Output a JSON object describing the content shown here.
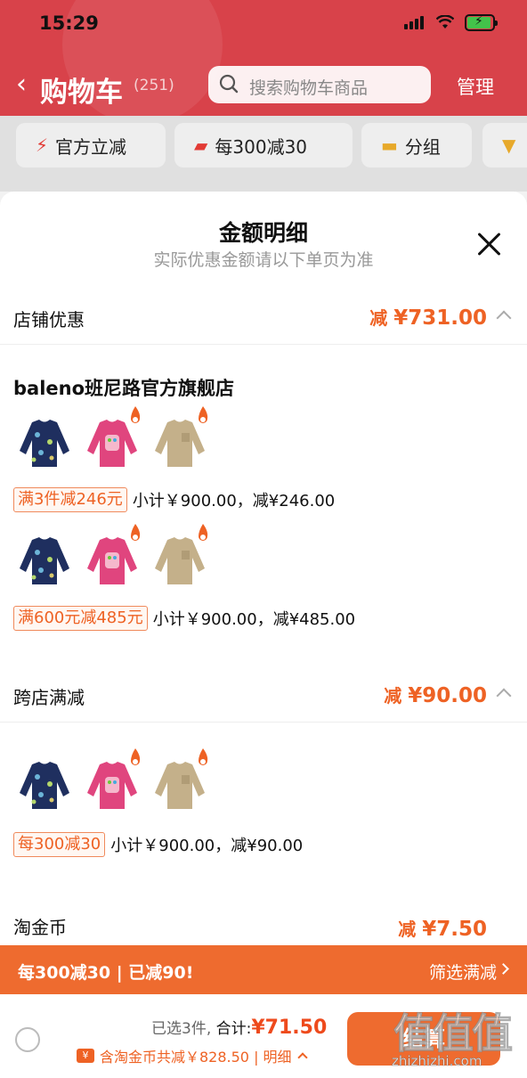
{
  "status_bar": {
    "time": "15:29"
  },
  "nav": {
    "title": "购物车",
    "count": "(251)",
    "search_placeholder": "搜索购物车商品",
    "manage": "管理"
  },
  "filters": [
    {
      "label": "官方立减",
      "icon": "lightning-icon"
    },
    {
      "label": "每300减30",
      "icon": "coupon-icon"
    },
    {
      "label": "分组",
      "icon": "folder-icon"
    }
  ],
  "sheet": {
    "title": "金额明细",
    "subtitle": "实际优惠金额请以下单页为准",
    "sections": {
      "shop_discount": {
        "name": "店铺优惠",
        "amount_prefix": "减",
        "amount": "¥731.00",
        "shop_name": "baleno班尼路官方旗舰店",
        "promos": [
          {
            "tag": "满3件减246元",
            "summary": "小计￥900.00，减¥246.00"
          },
          {
            "tag": "满600元减485元",
            "summary": "小计￥900.00，减¥485.00"
          }
        ]
      },
      "cross_shop": {
        "name": "跨店满减",
        "amount_prefix": "减",
        "amount": "¥90.00",
        "promos": [
          {
            "tag": "每300减30",
            "summary": "小计￥900.00，减¥90.00"
          }
        ]
      },
      "gold_coin": {
        "name": "淘金币",
        "amount_prefix": "减",
        "amount": "¥7.50"
      }
    }
  },
  "banner": {
    "left": "每300减30 | 已减90!",
    "right": "筛选满减"
  },
  "bottom_bar": {
    "selected": "已选3件,",
    "total_label": "合计:",
    "total": "¥71.50",
    "discount": "含淘金币共减￥828.50 | 明细",
    "checkout": "结算",
    "watermark": "值值值",
    "watermark_url": "zhizhizhi.com"
  },
  "colors": {
    "header_red": "#d8424a",
    "accent_orange": "#ee6224",
    "banner_orange": "#ee6b2f"
  }
}
